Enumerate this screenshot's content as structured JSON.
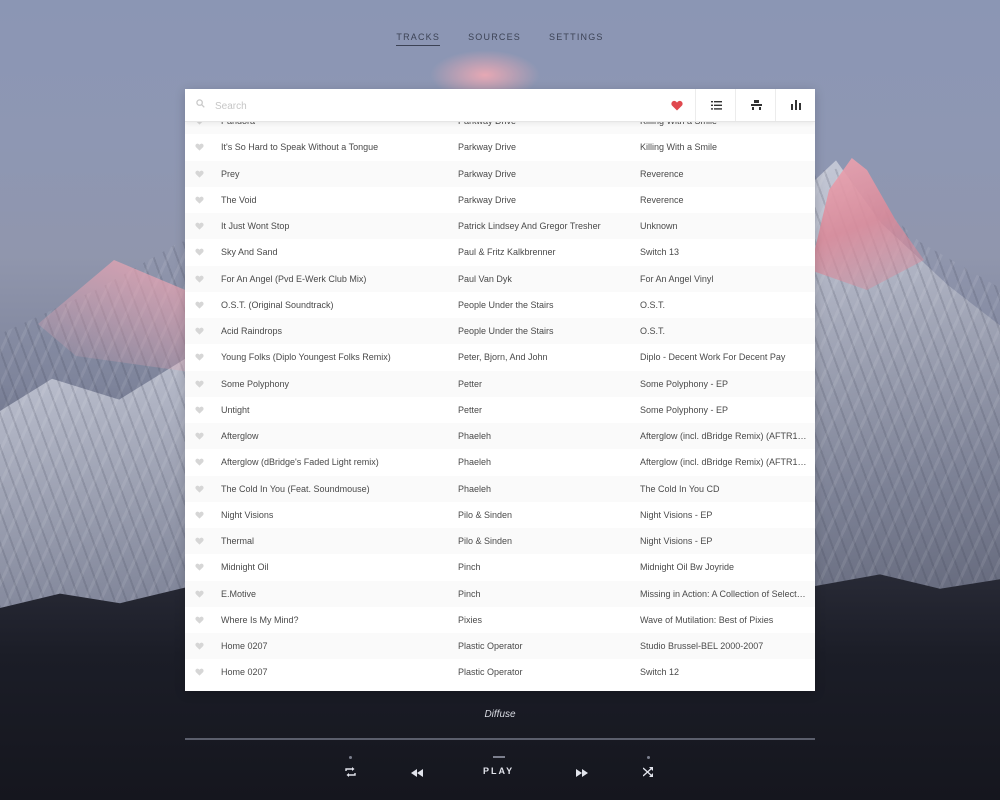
{
  "nav": {
    "tabs": [
      {
        "label": "TRACKS",
        "active": true
      },
      {
        "label": "SOURCES",
        "active": false
      },
      {
        "label": "SETTINGS",
        "active": false
      }
    ]
  },
  "search": {
    "placeholder": "Search",
    "value": ""
  },
  "toolbar": {
    "buttons": [
      {
        "icon": "heart-icon",
        "color": "#e0494f"
      },
      {
        "icon": "list-icon"
      },
      {
        "icon": "queue-icon"
      },
      {
        "icon": "bar-chart-icon"
      }
    ]
  },
  "tracks": [
    {
      "title": "Pandora",
      "artist": "Parkway Drive",
      "album": "Killing With a Smile"
    },
    {
      "title": "It's So Hard to Speak Without a Tongue",
      "artist": "Parkway Drive",
      "album": "Killing With a Smile"
    },
    {
      "title": "Prey",
      "artist": "Parkway Drive",
      "album": "Reverence"
    },
    {
      "title": "The Void",
      "artist": "Parkway Drive",
      "album": "Reverence"
    },
    {
      "title": "It Just Wont Stop",
      "artist": "Patrick Lindsey And Gregor Tresher",
      "album": "Unknown"
    },
    {
      "title": "Sky And Sand",
      "artist": "Paul & Fritz Kalkbrenner",
      "album": "Switch 13"
    },
    {
      "title": "For An Angel (Pvd E-Werk Club Mix)",
      "artist": "Paul Van Dyk",
      "album": "For An Angel Vinyl"
    },
    {
      "title": "O.S.T. (Original Soundtrack)",
      "artist": "People Under the Stairs",
      "album": "O.S.T."
    },
    {
      "title": "Acid Raindrops",
      "artist": "People Under the Stairs",
      "album": "O.S.T."
    },
    {
      "title": "Young Folks (Diplo Youngest Folks Remix)",
      "artist": "Peter, Bjorn, And John",
      "album": "Diplo - Decent Work For Decent Pay"
    },
    {
      "title": "Some Polyphony",
      "artist": "Petter",
      "album": "Some Polyphony - EP"
    },
    {
      "title": "Untight",
      "artist": "Petter",
      "album": "Some Polyphony - EP"
    },
    {
      "title": "Afterglow",
      "artist": "Phaeleh",
      "album": "Afterglow (incl. dBridge Remix) (AFTR12…"
    },
    {
      "title": "Afterglow (dBridge's Faded Light remix)",
      "artist": "Phaeleh",
      "album": "Afterglow (incl. dBridge Remix) (AFTR12…"
    },
    {
      "title": "The Cold In You (Feat. Soundmouse)",
      "artist": "Phaeleh",
      "album": "The Cold In You CD"
    },
    {
      "title": "Night Visions",
      "artist": "Pilo & Sinden",
      "album": "Night Visions - EP"
    },
    {
      "title": "Thermal",
      "artist": "Pilo & Sinden",
      "album": "Night Visions - EP"
    },
    {
      "title": "Midnight Oil",
      "artist": "Pinch",
      "album": "Midnight Oil Bw Joyride"
    },
    {
      "title": "E.Motive",
      "artist": "Pinch",
      "album": "Missing in Action: A Collection of Selecte…"
    },
    {
      "title": "Where Is My Mind?",
      "artist": "Pixies",
      "album": "Wave of Mutilation: Best of Pixies"
    },
    {
      "title": "Home 0207",
      "artist": "Plastic Operator",
      "album": "Studio Brussel-BEL 2000-2007"
    },
    {
      "title": "Home 0207",
      "artist": "Plastic Operator",
      "album": "Switch 12"
    }
  ],
  "player": {
    "now_playing": "Diffuse",
    "progress": 0,
    "play_label": "PLAY",
    "repeat_icon": "repeat-icon",
    "previous_icon": "previous-icon",
    "next_icon": "next-icon",
    "shuffle_icon": "shuffle-icon"
  }
}
